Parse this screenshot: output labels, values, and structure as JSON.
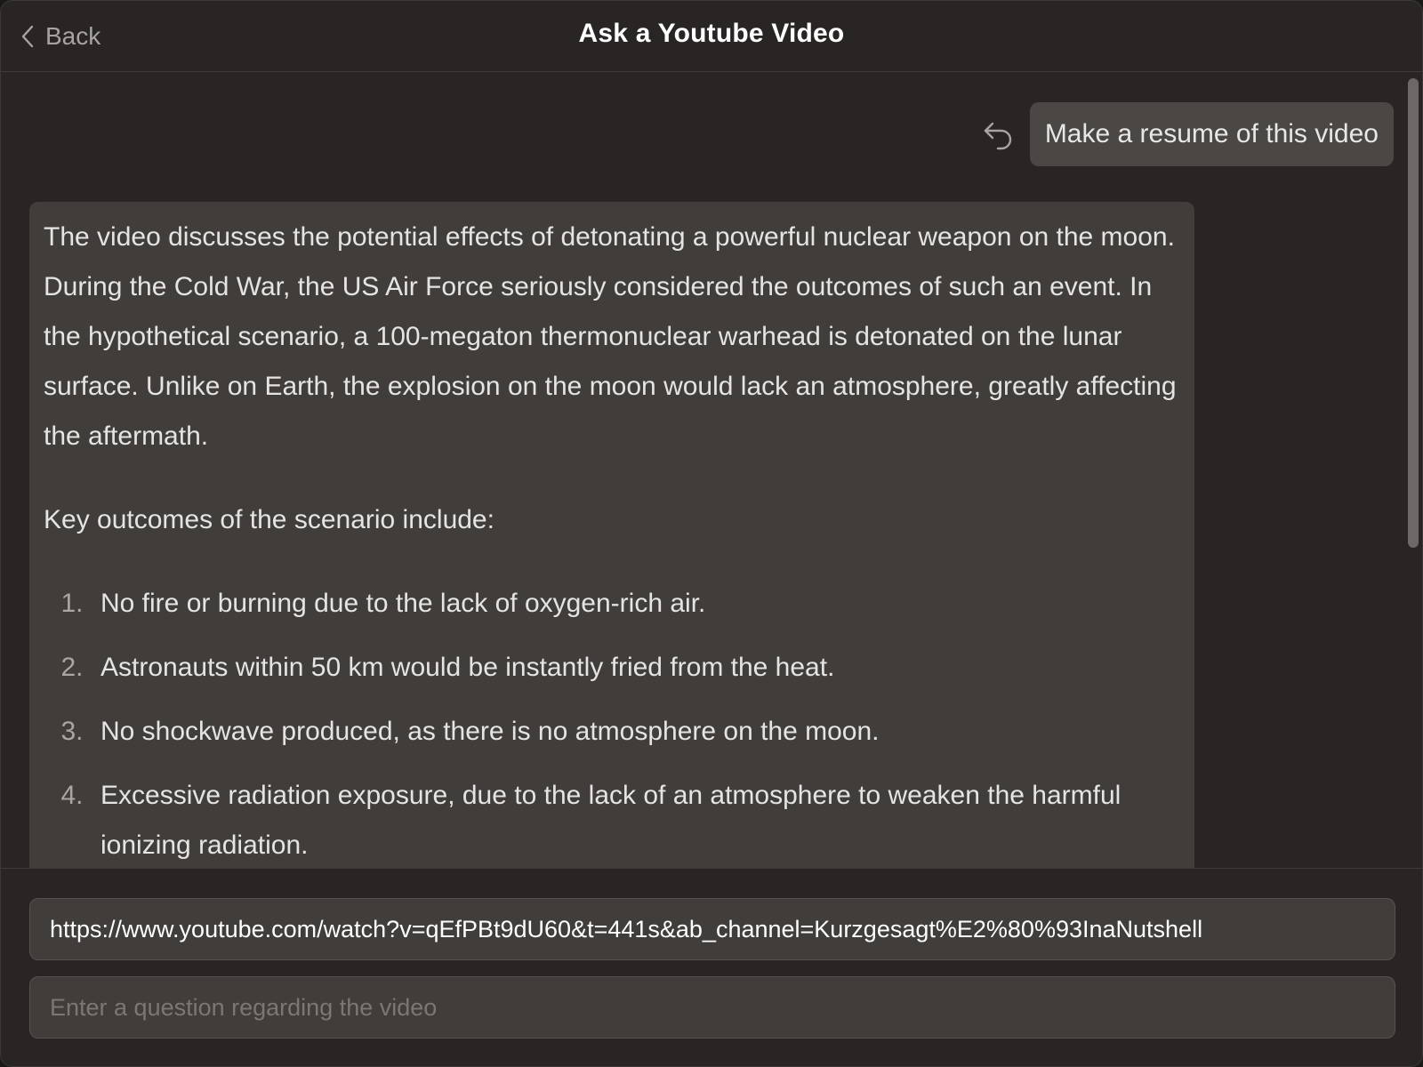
{
  "header": {
    "back_label": "Back",
    "title": "Ask a Youtube Video"
  },
  "conversation": {
    "user_message": "Make a resume of this video",
    "reply": {
      "intro": "The video discusses the potential effects of detonating a powerful nuclear weapon on the moon. During the Cold War, the US Air Force seriously considered the outcomes of such an event. In the hypothetical scenario, a 100-megaton thermonuclear warhead is detonated on the lunar surface. Unlike on Earth, the explosion on the moon would lack an atmosphere, greatly affecting the aftermath.",
      "lead": "Key outcomes of the scenario include:",
      "outcomes": [
        {
          "number": "1.",
          "text": "No fire or burning due to the lack of oxygen-rich air."
        },
        {
          "number": "2.",
          "text": "Astronauts within 50 km would be instantly fried from the heat."
        },
        {
          "number": "3.",
          "text": "No shockwave produced, as there is no atmosphere on the moon."
        },
        {
          "number": "4.",
          "text": "Excessive radiation exposure, due to the lack of an atmosphere to weaken the harmful ionizing radiation."
        }
      ]
    }
  },
  "inputs": {
    "video_url": "https://www.youtube.com/watch?v=qEfPBt9dU60&t=441s&ab_channel=Kurzgesagt%E2%80%93InaNutshell",
    "question_placeholder": "Enter a question regarding the video"
  },
  "icons": {
    "back": "chevron-left-icon",
    "retry": "undo-arrow-icon"
  },
  "colors": {
    "window_background": "#282524",
    "bubble_background": "#403d3a",
    "user_bubble_background": "#4a4744"
  }
}
